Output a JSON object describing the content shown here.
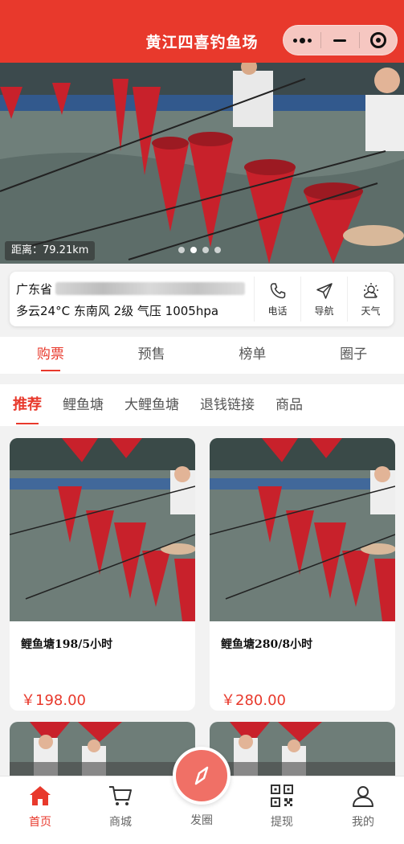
{
  "header": {
    "title": "黄江四喜钓鱼场"
  },
  "capsule": {
    "more_icon": "more-dots-icon",
    "minimize_icon": "minimize-icon",
    "close_icon": "target-close-icon"
  },
  "banner": {
    "distance": "距离：79.21km",
    "slides": 4,
    "active_slide": 1
  },
  "info": {
    "address_prefix": "广东省",
    "weather": "多云24°C  东南风 2级 气压 1005hpa",
    "actions": [
      {
        "label": "电话",
        "icon": "phone-icon"
      },
      {
        "label": "导航",
        "icon": "navigation-icon"
      },
      {
        "label": "天气",
        "icon": "weather-icon"
      }
    ]
  },
  "main_tabs": [
    "购票",
    "预售",
    "榜单",
    "圈子"
  ],
  "main_tab_active": 0,
  "sub_tabs": [
    "推荐",
    "鲤鱼塘",
    "大鲤鱼塘",
    "退钱链接",
    "商品"
  ],
  "sub_tab_active": 0,
  "products": [
    {
      "name": "鲤鱼塘198/5小时",
      "price": "￥198.00"
    },
    {
      "name": "鲤鱼塘280/8小时",
      "price": "￥280.00"
    }
  ],
  "bottom_nav": [
    {
      "label": "首页",
      "icon": "home-icon",
      "active": true
    },
    {
      "label": "商城",
      "icon": "cart-icon"
    },
    {
      "label": "发圈",
      "icon": "compass-icon"
    },
    {
      "label": "提现",
      "icon": "qr-code-icon"
    },
    {
      "label": "我的",
      "icon": "user-icon"
    }
  ],
  "colors": {
    "accent": "#e8392c",
    "fab": "#f07066"
  }
}
